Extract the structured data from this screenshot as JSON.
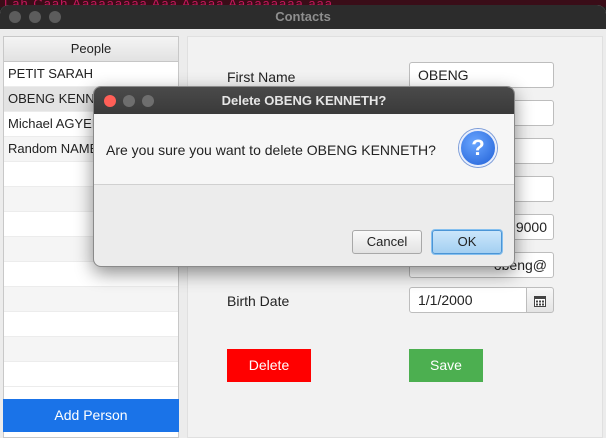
{
  "window": {
    "title": "Contacts"
  },
  "background_text": "Lah Caah Aaaaaaaaa Aaa Aaaaa  Aaaaaaaaa aaa",
  "people_list": {
    "header": "People",
    "items": [
      "PETIT SARAH",
      "OBENG KENNETH",
      "Michael AGYEMANG",
      "Random NAME"
    ],
    "selected_index": 1,
    "add_button_label": "Add Person"
  },
  "form": {
    "fields": [
      {
        "label": "First Name",
        "value": "OBENG"
      },
      {
        "label": "",
        "value": ""
      },
      {
        "label": "",
        "value": ""
      },
      {
        "label": "",
        "value": ""
      },
      {
        "label": "",
        "value": "9000"
      },
      {
        "label": "",
        "value": "obeng@"
      }
    ],
    "birth_date_label": "Birth Date",
    "birth_date_value": "1/1/2000",
    "calendar_icon": "calendar-icon",
    "delete_label": "Delete",
    "save_label": "Save",
    "colors": {
      "delete": "#ff0000",
      "save": "#4caf50",
      "add": "#1a73e8"
    }
  },
  "dialog": {
    "title": "Delete OBENG KENNETH?",
    "message": "Are you sure you want to delete OBENG KENNETH?",
    "icon": "question-icon",
    "cancel_label": "Cancel",
    "ok_label": "OK"
  }
}
